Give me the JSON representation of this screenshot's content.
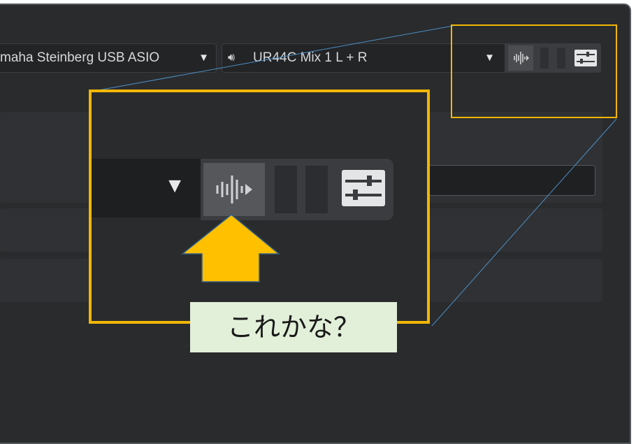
{
  "toolbar": {
    "input_device": "maha Steinberg USB ASIO",
    "input_arrow": "▼",
    "output_icon": "speaker-icon",
    "output_speaker_glyph": "🔊︎",
    "output_device": "UR44C Mix 1 L + R",
    "output_arrow": "▼"
  },
  "zoom": {
    "dropdown_arrow": "▼"
  },
  "annotation": {
    "label": "これかな？"
  },
  "colors": {
    "highlight": "#f2b705",
    "background": "#2a2b2d",
    "label_bg": "#e2efd9"
  }
}
